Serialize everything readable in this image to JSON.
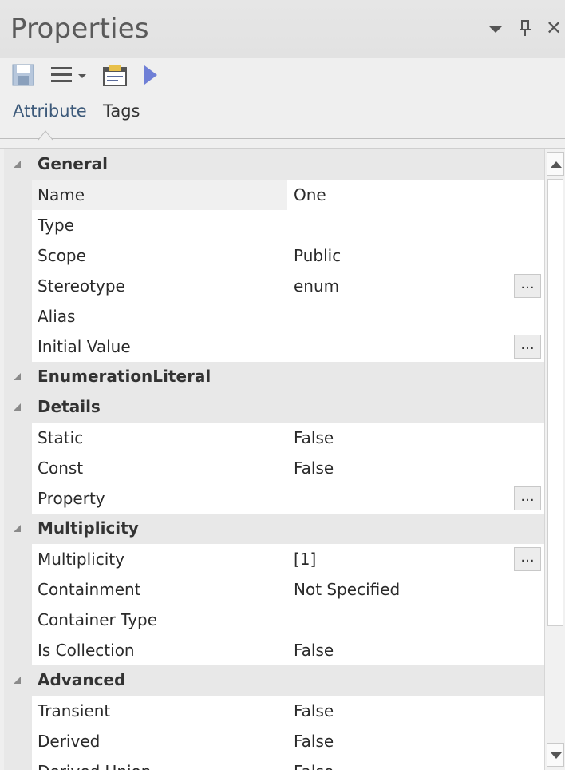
{
  "window": {
    "title": "Properties",
    "controls": {
      "dropdown_icon": "chevron-down-icon",
      "pin_icon": "pin-icon",
      "close_icon": "close-icon",
      "close_glyph": "✕"
    }
  },
  "toolbar": {
    "tools": [
      {
        "name": "save-icon"
      },
      {
        "name": "list-menu-icon"
      },
      {
        "name": "properties-dialog-icon"
      },
      {
        "name": "play-icon"
      }
    ]
  },
  "tabs": [
    {
      "label": "Attribute",
      "active": true
    },
    {
      "label": "Tags",
      "active": false
    }
  ],
  "grid": {
    "ellipsis_label": "...",
    "rows": [
      {
        "kind": "category",
        "label": "General"
      },
      {
        "kind": "prop",
        "name": "Name",
        "value": "One",
        "selected": true
      },
      {
        "kind": "prop",
        "name": "Type",
        "value": ""
      },
      {
        "kind": "prop",
        "name": "Scope",
        "value": "Public"
      },
      {
        "kind": "prop",
        "name": "Stereotype",
        "value": "enum",
        "ellipsis": true
      },
      {
        "kind": "prop",
        "name": "Alias",
        "value": ""
      },
      {
        "kind": "prop",
        "name": "Initial Value",
        "value": "",
        "ellipsis": true
      },
      {
        "kind": "category",
        "label": "EnumerationLiteral"
      },
      {
        "kind": "category",
        "label": "Details"
      },
      {
        "kind": "prop",
        "name": "Static",
        "value": "False"
      },
      {
        "kind": "prop",
        "name": "Const",
        "value": "False"
      },
      {
        "kind": "prop",
        "name": "Property",
        "value": "",
        "ellipsis": true
      },
      {
        "kind": "category",
        "label": "Multiplicity"
      },
      {
        "kind": "prop",
        "name": "Multiplicity",
        "value": "[1]",
        "ellipsis": true
      },
      {
        "kind": "prop",
        "name": "Containment",
        "value": "Not Specified"
      },
      {
        "kind": "prop",
        "name": "Container Type",
        "value": ""
      },
      {
        "kind": "prop",
        "name": "Is Collection",
        "value": "False"
      },
      {
        "kind": "category",
        "label": "Advanced"
      },
      {
        "kind": "prop",
        "name": "Transient",
        "value": "False"
      },
      {
        "kind": "prop",
        "name": "Derived",
        "value": "False"
      },
      {
        "kind": "prop",
        "name": "Derived Union",
        "value": "False"
      }
    ]
  }
}
